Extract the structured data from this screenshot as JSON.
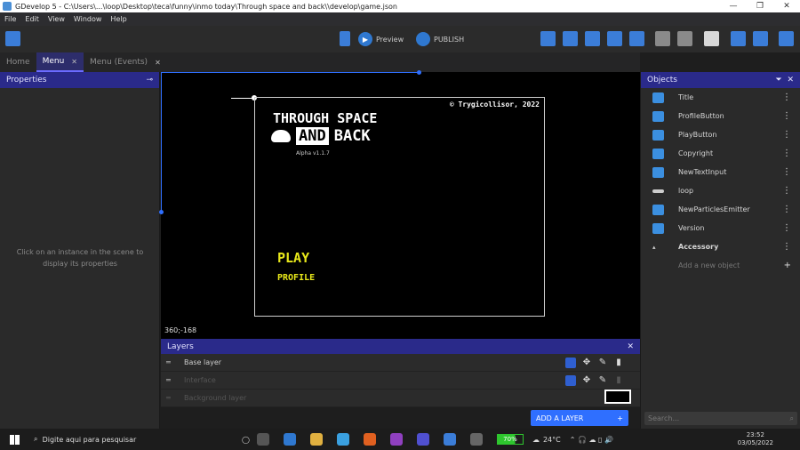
{
  "window": {
    "title": "GDevelop 5 - C:\\Users\\...\\loop\\Desktop\\teca\\funny\\inmo today\\Through space and back\\\\develop\\game.json",
    "minimize": "—",
    "maximize": "❐",
    "close": "✕"
  },
  "menubar": [
    "File",
    "Edit",
    "View",
    "Window",
    "Help"
  ],
  "toolbar": {
    "preview_label": "Preview",
    "publish_label": "PUBLISH"
  },
  "tabs": [
    {
      "label": "Home",
      "active": false,
      "closable": false
    },
    {
      "label": "Menu",
      "active": true,
      "closable": true
    },
    {
      "label": "Menu (Events)",
      "active": false,
      "closable": true
    }
  ],
  "properties": {
    "title": "Properties",
    "hint": "Click on an instance in the scene to display its properties"
  },
  "scene": {
    "copyright": "© Trygicollisor, 2022",
    "title_line1": "THROUGH SPACE",
    "title_and": "AND",
    "title_back": "BACK",
    "version": "Alpha v1.1.7",
    "play": "PLAY",
    "profile": "PROFILE",
    "coords": "360;-168"
  },
  "layers": {
    "title": "Layers",
    "rows": [
      {
        "name": "Base layer",
        "faded": false
      },
      {
        "name": "Interface",
        "faded": true
      },
      {
        "name": "Background layer",
        "faded": true
      }
    ],
    "add_label": "ADD A LAYER",
    "add_icon": "+"
  },
  "objects": {
    "title": "Objects",
    "items": [
      {
        "name": "Title",
        "icon": "sprite"
      },
      {
        "name": "ProfileButton",
        "icon": "sprite"
      },
      {
        "name": "PlayButton",
        "icon": "sprite"
      },
      {
        "name": "Copyright",
        "icon": "sprite"
      },
      {
        "name": "NewTextInput",
        "icon": "text"
      },
      {
        "name": "loop",
        "icon": "bar"
      },
      {
        "name": "NewParticlesEmitter",
        "icon": "particles"
      },
      {
        "name": "Version",
        "icon": "sprite"
      }
    ],
    "group": "Accessory",
    "add_new": "Add a new object",
    "search_placeholder": "Search..."
  },
  "taskbar": {
    "search": "Digite aqui para pesquisar",
    "battery": "70%",
    "weather": "24°C",
    "time": "23:52",
    "date": "03/05/2022"
  },
  "colors": {
    "accent": "#2f6fff",
    "panel_header": "#2a2a8a",
    "game_text": "#e8e81a"
  }
}
